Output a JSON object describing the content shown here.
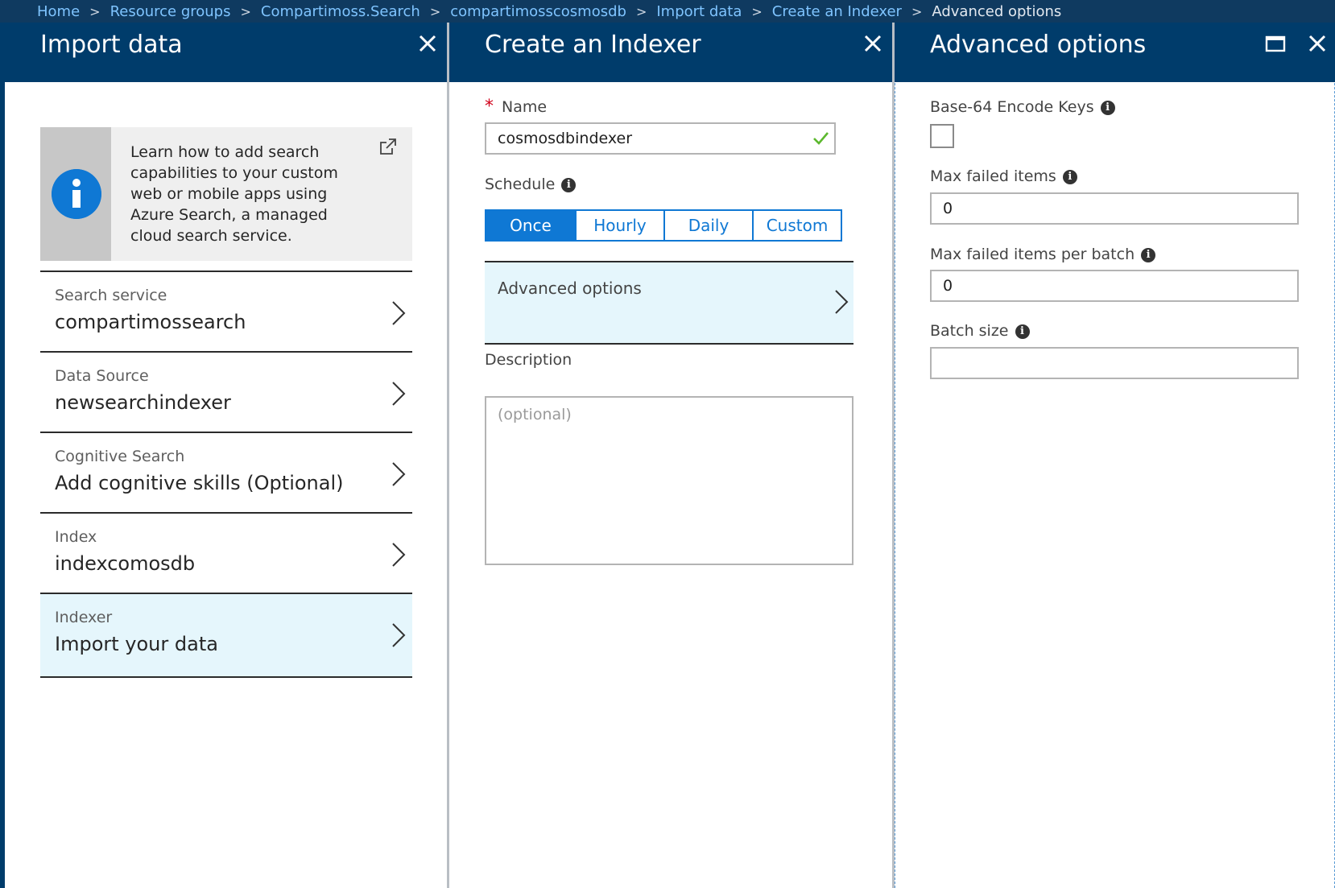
{
  "breadcrumb": {
    "items": [
      "Home",
      "Resource groups",
      "Compartimoss.Search",
      "compartimosscosmosdb",
      "Import data",
      "Create an Indexer"
    ],
    "current": "Advanced options"
  },
  "blade1": {
    "title": "Import data",
    "info_text": "Learn how to add search capabilities to your custom web or mobile apps using Azure Search, a managed cloud search service.",
    "nav": [
      {
        "label": "Search service",
        "value": "compartimossearch"
      },
      {
        "label": "Data Source",
        "value": "newsearchindexer"
      },
      {
        "label": "Cognitive Search",
        "value": "Add cognitive skills (Optional)"
      },
      {
        "label": "Index",
        "value": "indexcomosdb"
      },
      {
        "label": "Indexer",
        "value": "Import your data"
      }
    ]
  },
  "blade2": {
    "title": "Create an Indexer",
    "name_label": "Name",
    "name_value": "cosmosdbindexer",
    "schedule_label": "Schedule",
    "schedule_options": [
      "Once",
      "Hourly",
      "Daily",
      "Custom"
    ],
    "schedule_selected": "Once",
    "advanced_label": "Advanced options",
    "description_label": "Description",
    "description_placeholder": "(optional)"
  },
  "blade3": {
    "title": "Advanced options",
    "base64_label": "Base-64 Encode Keys",
    "max_failed_label": "Max failed items",
    "max_failed_value": "0",
    "max_failed_batch_label": "Max failed items per batch",
    "max_failed_batch_value": "0",
    "batch_size_label": "Batch size",
    "batch_size_value": ""
  },
  "colors": {
    "header": "#003c6b",
    "breadcrumb_bg": "#0f3a60",
    "accent": "#0f78d4",
    "selected_bg": "#e5f6fc",
    "valid": "#5cb82e",
    "required": "#d0021b"
  },
  "icons": [
    "close-icon",
    "maximize-icon",
    "info-icon",
    "external-link-icon",
    "chevron-right-icon",
    "checkmark-icon"
  ]
}
